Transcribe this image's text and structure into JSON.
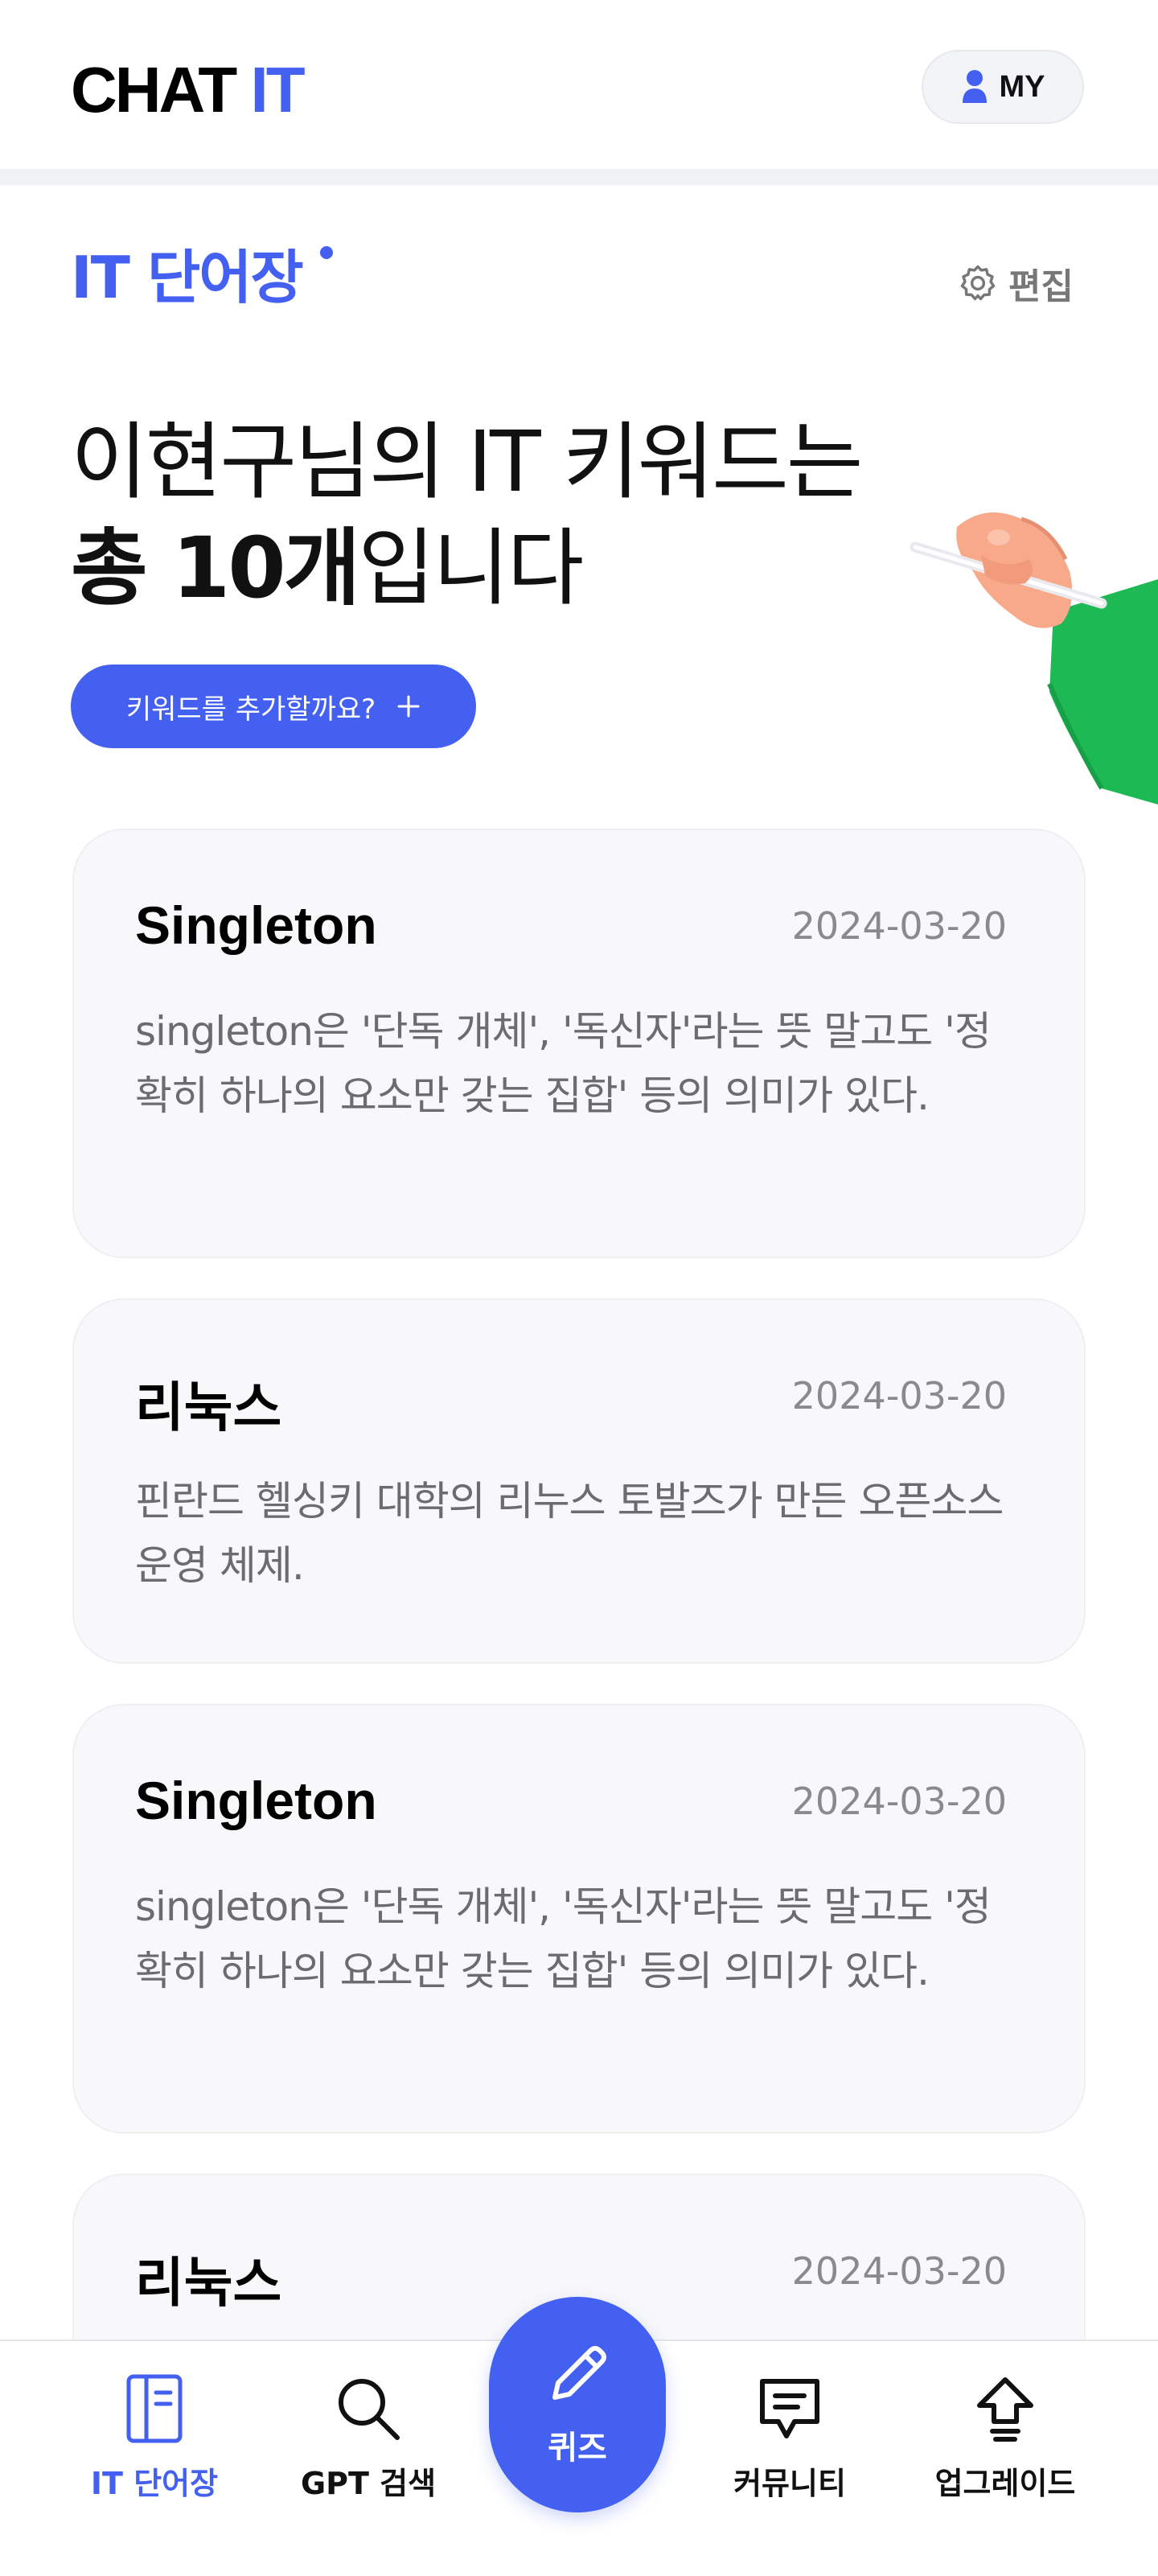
{
  "header": {
    "logo_part1": "CHAT",
    "logo_part2": "IT",
    "my_label": "MY"
  },
  "section": {
    "title": "IT 단어장",
    "edit_label": "편집"
  },
  "headline": {
    "line1": "이현구님의 IT 키워드는",
    "line2_bold": "총 10개",
    "line2_rest": "입니다"
  },
  "add_button": {
    "label": "키워드를 추가할까요?",
    "icon": "plus-icon"
  },
  "cards": [
    {
      "term": "Singleton",
      "date": "2024-03-20",
      "desc": "singleton은 '단독 개체', '독신자'라는 뜻 말고도 '정확히 하나의 요소만 갖는 집합' 등의 의미가 있다."
    },
    {
      "term": "리눅스",
      "date": "2024-03-20",
      "desc": "핀란드 헬싱키 대학의 리누스 토발즈가 만든 오픈소스 운영 체제."
    },
    {
      "term": "Singleton",
      "date": "2024-03-20",
      "desc": "singleton은 '단독 개체', '독신자'라는 뜻 말고도 '정확히 하나의 요소만 갖는 집합' 등의 의미가 있다."
    },
    {
      "term": "리눅스",
      "date": "2024-03-20",
      "desc": ""
    }
  ],
  "tabbar": {
    "tabs": [
      {
        "label": "IT 단어장",
        "icon": "notebook-icon",
        "active": true
      },
      {
        "label": "GPT 검색",
        "icon": "search-icon",
        "active": false
      },
      {
        "label": "퀴즈",
        "icon": "pencil-icon",
        "active": false
      },
      {
        "label": "커뮤니티",
        "icon": "chat-icon",
        "active": false
      },
      {
        "label": "업그레이드",
        "icon": "upgrade-arrow-icon",
        "active": false
      }
    ]
  },
  "colors": {
    "accent": "#4360f1",
    "card_bg": "#f8f8fa",
    "muted_text": "#6b6b70",
    "date_text": "#8a8a8e",
    "sleeve": "#1db954"
  }
}
